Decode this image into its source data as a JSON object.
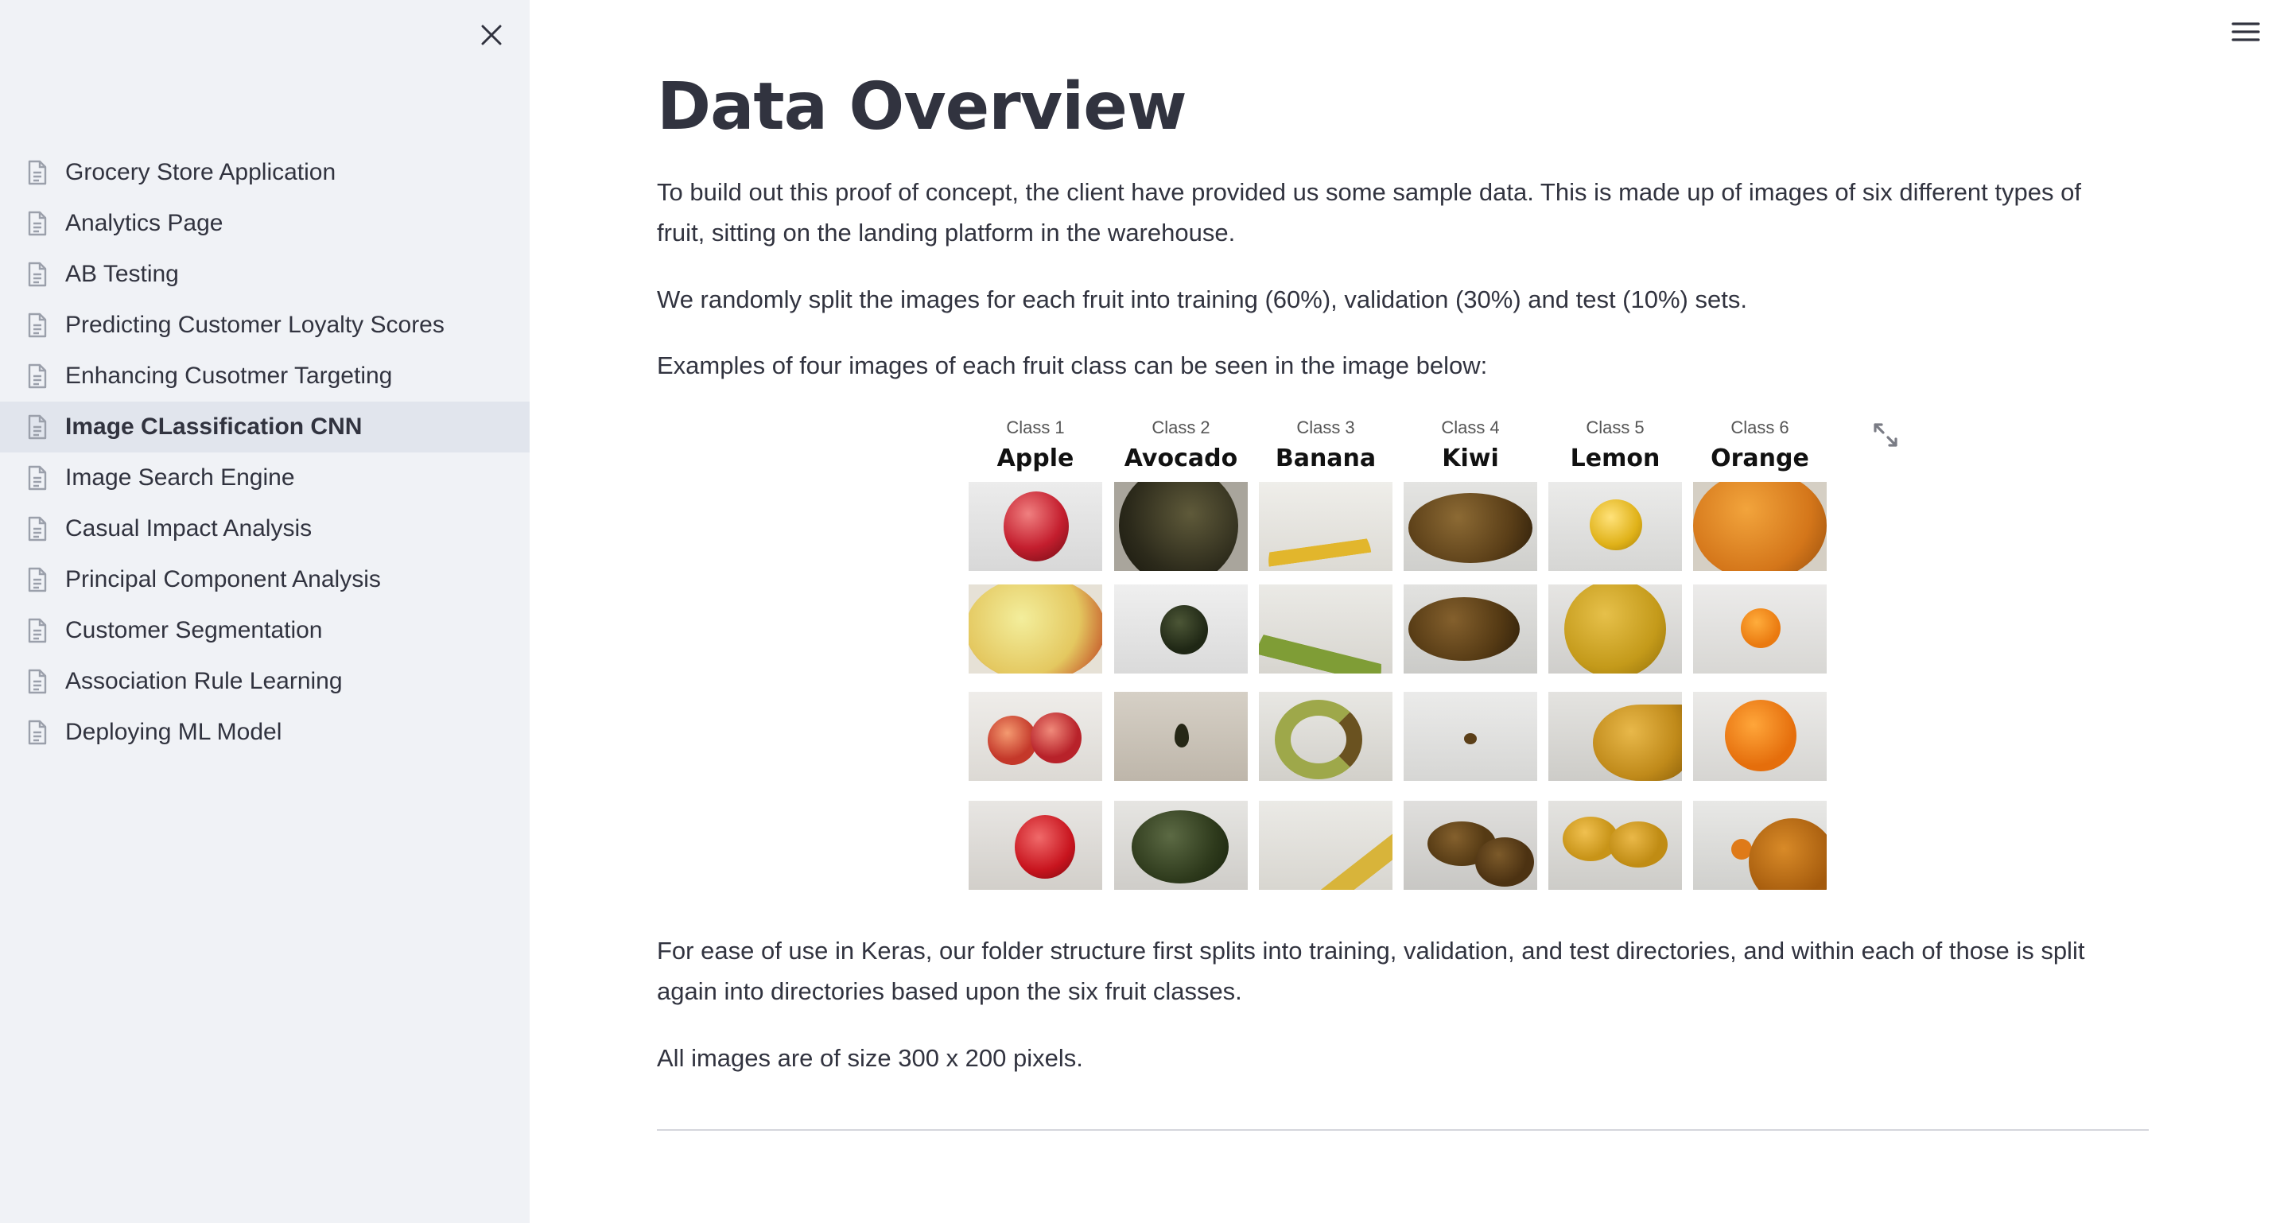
{
  "sidebar": {
    "close_icon": "close-icon",
    "items": [
      {
        "label": "Grocery Store Application",
        "icon": "page-icon",
        "active": false
      },
      {
        "label": "Analytics Page",
        "icon": "page-icon",
        "active": false
      },
      {
        "label": "AB Testing",
        "icon": "page-icon",
        "active": false
      },
      {
        "label": "Predicting Customer Loyalty Scores",
        "icon": "page-icon",
        "active": false
      },
      {
        "label": "Enhancing Cusotmer Targeting",
        "icon": "page-icon",
        "active": false
      },
      {
        "label": "Image CLassification CNN",
        "icon": "page-icon",
        "active": true
      },
      {
        "label": "Image Search Engine",
        "icon": "page-icon",
        "active": false
      },
      {
        "label": "Casual Impact Analysis",
        "icon": "page-icon",
        "active": false
      },
      {
        "label": "Principal Component Analysis",
        "icon": "page-icon",
        "active": false
      },
      {
        "label": "Customer Segmentation",
        "icon": "page-icon",
        "active": false
      },
      {
        "label": "Association Rule Learning",
        "icon": "page-icon",
        "active": false
      },
      {
        "label": "Deploying ML Model",
        "icon": "page-icon",
        "active": false
      }
    ]
  },
  "header": {
    "menu_icon": "hamburger-menu-icon"
  },
  "main": {
    "title": "Data Overview",
    "paragraphs": [
      "To build out this proof of concept, the client have provided us some sample data. This is made up of images of six different types of fruit, sitting on the landing platform in the warehouse.",
      "We randomly split the images for each fruit into training (60%), validation (30%) and test (10%) sets.",
      "Examples of four images of each fruit class can be seen in the image below:",
      "For ease of use in Keras, our folder structure first splits into training, validation, and test directories, and within each of those is split again into directories based upon the six fruit classes.",
      "All images are of size 300 x 200 pixels."
    ],
    "figure": {
      "expand_icon": "fullscreen-expand-icon",
      "classes": [
        {
          "num": "Class 1",
          "name": "Apple"
        },
        {
          "num": "Class 2",
          "name": "Avocado"
        },
        {
          "num": "Class 3",
          "name": "Banana"
        },
        {
          "num": "Class 4",
          "name": "Kiwi"
        },
        {
          "num": "Class 5",
          "name": "Lemon"
        },
        {
          "num": "Class 6",
          "name": "Orange"
        }
      ]
    }
  },
  "colors": {
    "sidebar_bg": "#f0f2f6",
    "active_item_bg": "#e1e5ed",
    "text": "#31333f",
    "divider": "#d4d6dc"
  }
}
